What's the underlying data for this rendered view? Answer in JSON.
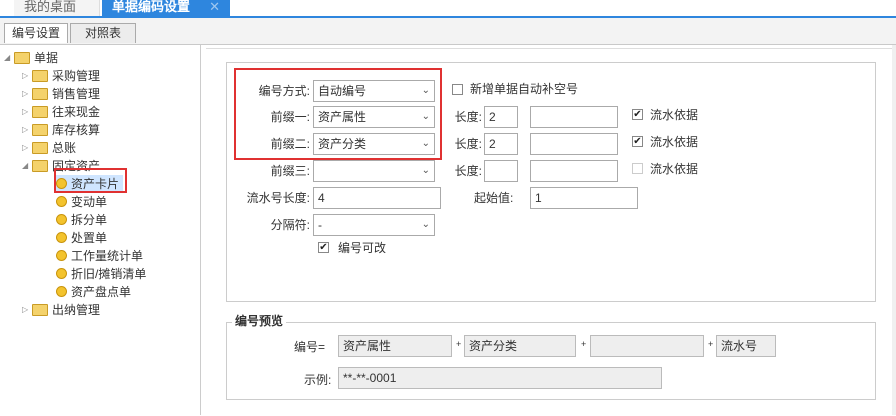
{
  "top_tabs": [
    {
      "label": "我的桌面"
    },
    {
      "label": "单据编码设置",
      "close": "✕"
    }
  ],
  "sub_tabs": [
    {
      "label": "编号设置"
    },
    {
      "label": "对照表"
    }
  ],
  "tree": {
    "root": "单据",
    "items": [
      {
        "label": "采购管理"
      },
      {
        "label": "销售管理"
      },
      {
        "label": "往来现金"
      },
      {
        "label": "库存核算"
      },
      {
        "label": "总账"
      },
      {
        "label": "固定资产"
      },
      {
        "label": "出纳管理"
      }
    ],
    "fixed_asset_children": [
      {
        "label": "资产卡片"
      },
      {
        "label": "变动单"
      },
      {
        "label": "拆分单"
      },
      {
        "label": "处置单"
      },
      {
        "label": "工作量统计单"
      },
      {
        "label": "折旧/摊销清单"
      },
      {
        "label": "资产盘点单"
      }
    ]
  },
  "form": {
    "mode_label": "编号方式:",
    "mode_value": "自动编号",
    "auto_fill_label": "新增单据自动补空号",
    "prefix1_label": "前缀一:",
    "prefix1_value": "资产属性",
    "prefix2_label": "前缀二:",
    "prefix2_value": "资产分类",
    "prefix3_label": "前缀三:",
    "prefix3_value": "",
    "length_label": "长度:",
    "len1": "2",
    "len2": "2",
    "len3": "",
    "serial_basis_label": "流水依据",
    "serial_len_label": "流水号长度:",
    "serial_len_value": "4",
    "start_label": "起始值:",
    "start_value": "1",
    "separator_label": "分隔符:",
    "separator_value": "-",
    "editable_label": "编号可改"
  },
  "preview": {
    "title": "编号预览",
    "number_label": "编号=",
    "part1": "资产属性",
    "part2": "资产分类",
    "part3": "",
    "part4": "流水号",
    "plus": "+",
    "example_label": "示例:",
    "example_value": "**-**-0001"
  },
  "colors": {
    "accent": "#2e86de",
    "highlight": "#e03131"
  },
  "icons": {
    "dropdown": "chevron-down-icon",
    "check": "checkmark-icon",
    "folder": "folder-icon",
    "leaf": "dot-icon"
  }
}
